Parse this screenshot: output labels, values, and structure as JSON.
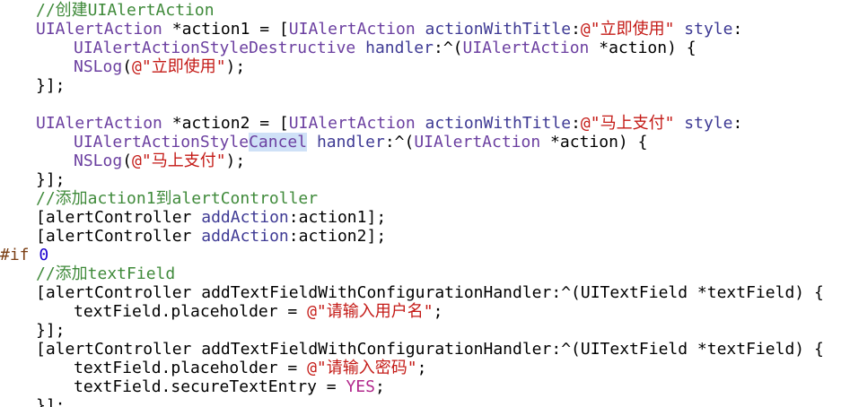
{
  "editor": {
    "colors": {
      "background": "#ffffff",
      "plain": "#000000",
      "comment": "#3f8a3a",
      "type": "#6b3fa0",
      "method": "#3e3a94",
      "string": "#c41a16",
      "keyword": "#b2288c",
      "preprocessor": "#7b3f14",
      "number": "#1c00cf",
      "selection": "#cfe1f7"
    },
    "lines": [
      {
        "indent": 1,
        "tokens": [
          {
            "t": "//创建UIAlertAction",
            "c": "comment"
          }
        ]
      },
      {
        "indent": 1,
        "tokens": [
          {
            "t": "UIAlertAction",
            "c": "type"
          },
          {
            "t": " *action1 = [",
            "c": "plain"
          },
          {
            "t": "UIAlertAction",
            "c": "type"
          },
          {
            "t": " ",
            "c": "plain"
          },
          {
            "t": "actionWithTitle",
            "c": "method"
          },
          {
            "t": ":",
            "c": "plain"
          },
          {
            "t": "@\"立即使用\"",
            "c": "string"
          },
          {
            "t": " ",
            "c": "plain"
          },
          {
            "t": "style",
            "c": "method"
          },
          {
            "t": ":",
            "c": "plain"
          }
        ]
      },
      {
        "indent": 2,
        "tokens": [
          {
            "t": "UIAlertActionStyleDestructive",
            "c": "type"
          },
          {
            "t": " ",
            "c": "plain"
          },
          {
            "t": "handler",
            "c": "method"
          },
          {
            "t": ":^(",
            "c": "plain"
          },
          {
            "t": "UIAlertAction",
            "c": "type"
          },
          {
            "t": " *action) {",
            "c": "plain"
          }
        ]
      },
      {
        "indent": 2,
        "tokens": [
          {
            "t": "NSLog",
            "c": "type"
          },
          {
            "t": "(",
            "c": "plain"
          },
          {
            "t": "@\"立即使用\"",
            "c": "string"
          },
          {
            "t": ");",
            "c": "plain"
          }
        ]
      },
      {
        "indent": 1,
        "tokens": [
          {
            "t": "}];",
            "c": "plain"
          }
        ]
      },
      {
        "indent": 0,
        "tokens": []
      },
      {
        "indent": 1,
        "tokens": [
          {
            "t": "UIAlertAction",
            "c": "type"
          },
          {
            "t": " *action2 = [",
            "c": "plain"
          },
          {
            "t": "UIAlertAction",
            "c": "type"
          },
          {
            "t": " ",
            "c": "plain"
          },
          {
            "t": "actionWithTitle",
            "c": "method"
          },
          {
            "t": ":",
            "c": "plain"
          },
          {
            "t": "@\"马上支付\"",
            "c": "string"
          },
          {
            "t": " ",
            "c": "plain"
          },
          {
            "t": "style",
            "c": "method"
          },
          {
            "t": ":",
            "c": "plain"
          }
        ]
      },
      {
        "indent": 2,
        "tokens": [
          {
            "t": "UIAlertActionStyle",
            "c": "type"
          },
          {
            "t": "Cancel",
            "c": "type",
            "hl": true
          },
          {
            "t": " ",
            "c": "plain"
          },
          {
            "t": "handler",
            "c": "method"
          },
          {
            "t": ":^(",
            "c": "plain"
          },
          {
            "t": "UIAlertAction",
            "c": "type"
          },
          {
            "t": " *action) {",
            "c": "plain"
          }
        ]
      },
      {
        "indent": 2,
        "tokens": [
          {
            "t": "NSLog",
            "c": "type"
          },
          {
            "t": "(",
            "c": "plain"
          },
          {
            "t": "@\"马上支付\"",
            "c": "string"
          },
          {
            "t": ");",
            "c": "plain"
          }
        ]
      },
      {
        "indent": 1,
        "tokens": [
          {
            "t": "}];",
            "c": "plain"
          }
        ]
      },
      {
        "indent": 1,
        "tokens": [
          {
            "t": "//添加action1到alertController",
            "c": "comment"
          }
        ]
      },
      {
        "indent": 1,
        "tokens": [
          {
            "t": "[alertController ",
            "c": "plain"
          },
          {
            "t": "addAction",
            "c": "method"
          },
          {
            "t": ":action1];",
            "c": "plain"
          }
        ]
      },
      {
        "indent": 1,
        "tokens": [
          {
            "t": "[alertController ",
            "c": "plain"
          },
          {
            "t": "addAction",
            "c": "method"
          },
          {
            "t": ":action2];",
            "c": "plain"
          }
        ]
      },
      {
        "indent": 0,
        "tokens": [
          {
            "t": "#if ",
            "c": "preprocessor"
          },
          {
            "t": "0",
            "c": "number"
          }
        ]
      },
      {
        "indent": 1,
        "tokens": [
          {
            "t": "//添加textField",
            "c": "comment"
          }
        ]
      },
      {
        "indent": 1,
        "tokens": [
          {
            "t": "[alertController addTextFieldWithConfigurationHandler:^(UITextField *textField) {",
            "c": "plain"
          }
        ]
      },
      {
        "indent": 2,
        "tokens": [
          {
            "t": "textField.placeholder = ",
            "c": "plain"
          },
          {
            "t": "@\"请输入用户名\"",
            "c": "string"
          },
          {
            "t": ";",
            "c": "plain"
          }
        ]
      },
      {
        "indent": 1,
        "tokens": [
          {
            "t": "}];",
            "c": "plain"
          }
        ]
      },
      {
        "indent": 1,
        "tokens": [
          {
            "t": "[alertController addTextFieldWithConfigurationHandler:^(UITextField *textField) {",
            "c": "plain"
          }
        ]
      },
      {
        "indent": 2,
        "tokens": [
          {
            "t": "textField.placeholder = ",
            "c": "plain"
          },
          {
            "t": "@\"请输入密码\"",
            "c": "string"
          },
          {
            "t": ";",
            "c": "plain"
          }
        ]
      },
      {
        "indent": 2,
        "tokens": [
          {
            "t": "textField.secureTextEntry = ",
            "c": "plain"
          },
          {
            "t": "YES",
            "c": "keyword"
          },
          {
            "t": ";",
            "c": "plain"
          }
        ]
      },
      {
        "indent": 1,
        "tokens": [
          {
            "t": "}];",
            "c": "plain"
          }
        ]
      }
    ]
  }
}
